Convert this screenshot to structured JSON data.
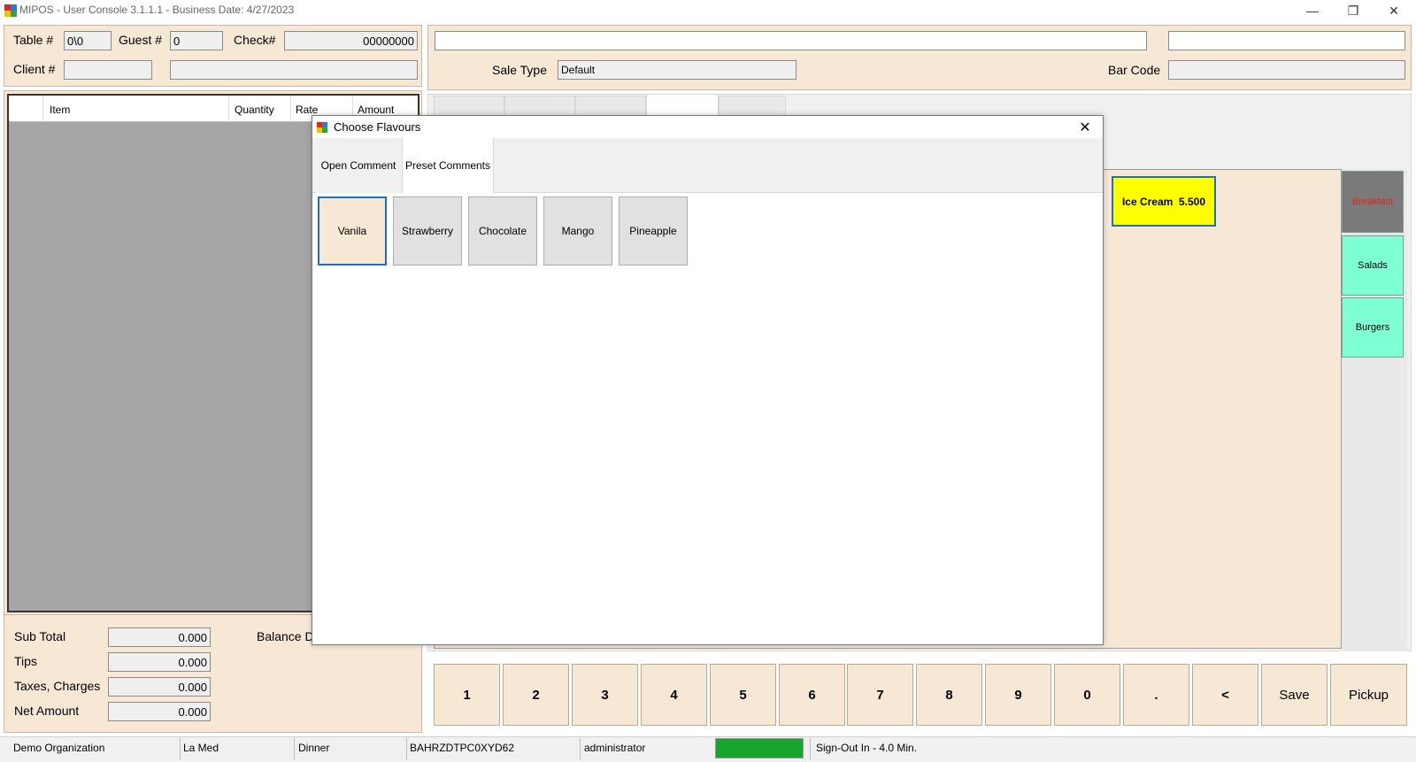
{
  "window": {
    "title": "MIPOS - User Console 3.1.1.1 - Business Date: 4/27/2023",
    "minimize": "—",
    "restore": "❐",
    "close": "✕"
  },
  "header": {
    "table_label": "Table #",
    "table_value": "0\\0",
    "guest_label": "Guest #",
    "guest_value": "0",
    "check_label": "Check#",
    "check_value": "00000000",
    "client_label": "Client #",
    "client_value": "",
    "client_name": ""
  },
  "right_header": {
    "sale_type_label": "Sale Type",
    "sale_type_value": "Default",
    "barcode_label": "Bar Code",
    "barcode_value": ""
  },
  "order_grid": {
    "columns": [
      "",
      "Item",
      "Quantity",
      "Rate",
      "Amount"
    ]
  },
  "totals": {
    "subtotal_label": "Sub Total",
    "subtotal_value": "0.000",
    "tips_label": "Tips",
    "tips_value": "0.000",
    "taxes_label": "Taxes, Charges",
    "taxes_value": "0.000",
    "net_label": "Net Amount",
    "net_value": "0.000",
    "balance_label": "Balance D"
  },
  "menu_item": {
    "label": "Ice Cream  5.500"
  },
  "categories": [
    {
      "label": "Breakfast",
      "color": "#7a7a7a",
      "text_color": "#e0231c"
    },
    {
      "label": "Salads",
      "color": "#7fffd4",
      "text_color": "#000000"
    },
    {
      "label": "Burgers",
      "color": "#7fffd4",
      "text_color": "#000000"
    }
  ],
  "keypad": {
    "keys": [
      "1",
      "2",
      "3",
      "4",
      "5",
      "6",
      "7",
      "8",
      "9",
      "0",
      ".",
      "<",
      "Save",
      "Pickup"
    ]
  },
  "status": {
    "organization": "Demo Organization",
    "location": "La Med",
    "session": "Dinner",
    "terminal": "BAHRZDTPC0XYD62",
    "user": "administrator",
    "indicator_color": "#16a62b",
    "signout": "Sign-Out In - 4.0 Min."
  },
  "dialog": {
    "title": "Choose Flavours",
    "close": "✕",
    "tabs": [
      "Open Comment",
      "Preset Comments"
    ],
    "flavours": [
      "Vanila",
      "Strawberry",
      "Chocolate",
      "Mango",
      "Pineapple"
    ]
  },
  "colors": {
    "panel": "#f7e8d6",
    "menu_item_bg": "#ffff00",
    "selection_border": "#1b6fc4"
  }
}
